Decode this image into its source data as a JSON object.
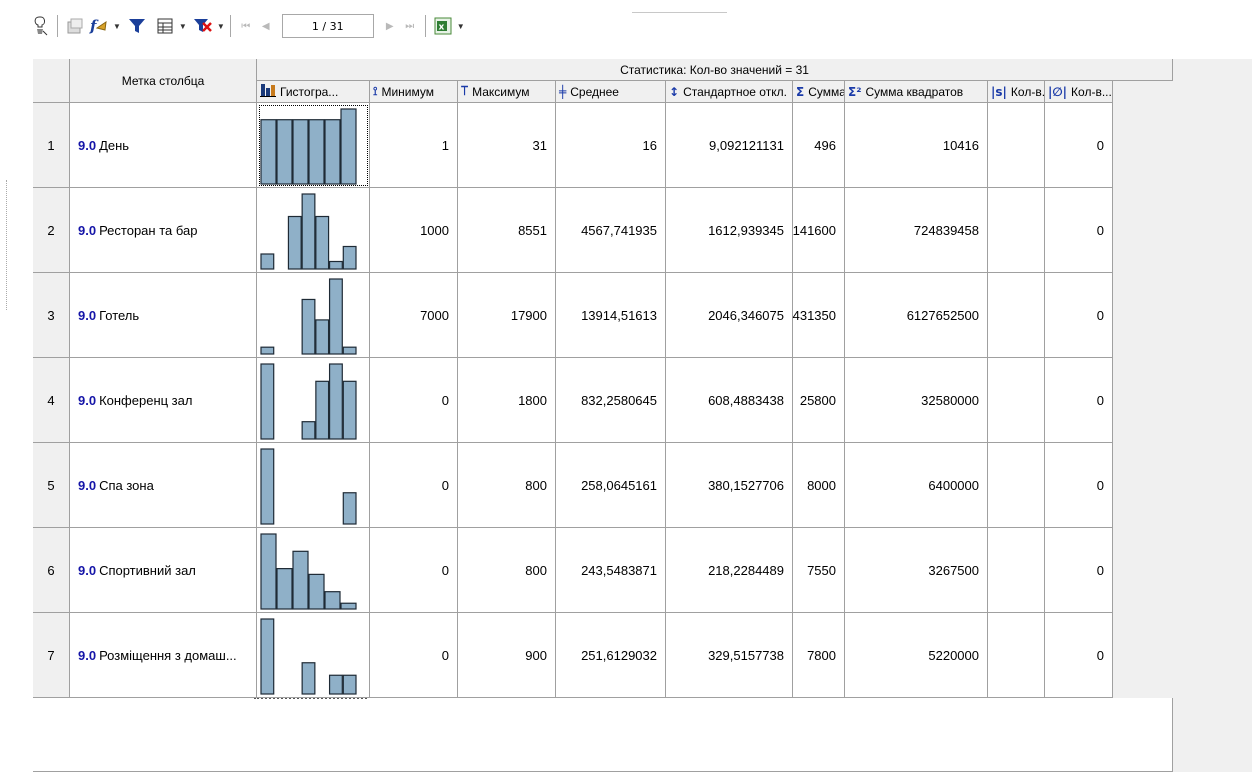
{
  "toolbar": {
    "icons": [
      "wizard-icon",
      "properties-icon",
      "formula-icon",
      "filter-icon",
      "table-view-icon",
      "clear-filter-icon"
    ],
    "page_indicator": "1 / 31",
    "export_icon": "excel-export-icon"
  },
  "grid": {
    "corner_label": "",
    "column_label_header": "Метка столбца",
    "group_header": "Статистика: Кол-во значений = 31",
    "columns": [
      {
        "key": "hist",
        "label": "Гистогра...",
        "icon": "histogram-icon",
        "sym": ""
      },
      {
        "key": "min",
        "label": "Минимум",
        "icon": "minimum-icon",
        "sym": "⟟"
      },
      {
        "key": "max",
        "label": "Максимум",
        "icon": "maximum-icon",
        "sym": "⟙"
      },
      {
        "key": "mean",
        "label": "Среднее",
        "icon": "mean-icon",
        "sym": "╪"
      },
      {
        "key": "std",
        "label": "Стандартное откл.",
        "icon": "std-dev-icon",
        "sym": "↕"
      },
      {
        "key": "sum",
        "label": "Сумма",
        "icon": "sum-icon",
        "sym": "Σ"
      },
      {
        "key": "sumsq",
        "label": "Сумма квадратов",
        "icon": "sum-squares-icon",
        "sym": "Σ²"
      },
      {
        "key": "cnt1",
        "label": "Кол-в...",
        "icon": "count-distinct-icon",
        "sym": "|s|"
      },
      {
        "key": "cnt2",
        "label": "Кол-в...",
        "icon": "count-empty-icon",
        "sym": "|∅|"
      }
    ],
    "rows": [
      {
        "no": "1",
        "tag": "9.0",
        "name": "День",
        "hist": [
          6,
          6,
          6,
          6,
          6,
          7
        ],
        "min": "1",
        "max": "31",
        "mean": "16",
        "std": "9,092121131",
        "sum": "496",
        "sumsq": "10416",
        "cnt1": "",
        "cnt2": "0"
      },
      {
        "no": "2",
        "tag": "9.0",
        "name": "Ресторан та бар",
        "hist": [
          2,
          0,
          7,
          10,
          7,
          1,
          3
        ],
        "min": "1000",
        "max": "8551",
        "mean": "4567,741935",
        "std": "1612,939345",
        "sum": "141600",
        "sumsq": "724839458",
        "cnt1": "",
        "cnt2": "0"
      },
      {
        "no": "3",
        "tag": "9.0",
        "name": "Готель",
        "hist": [
          1,
          0,
          0,
          8,
          5,
          11,
          1
        ],
        "min": "7000",
        "max": "17900",
        "mean": "13914,51613",
        "std": "2046,346075",
        "sum": "431350",
        "sumsq": "6127652500",
        "cnt1": "",
        "cnt2": "0"
      },
      {
        "no": "4",
        "tag": "9.0",
        "name": "Конференц зал",
        "hist": [
          13,
          0,
          0,
          3,
          10,
          13,
          10
        ],
        "min": "0",
        "max": "1800",
        "mean": "832,2580645",
        "std": "608,4883438",
        "sum": "25800",
        "sumsq": "32580000",
        "cnt1": "",
        "cnt2": "0"
      },
      {
        "no": "5",
        "tag": "9.0",
        "name": "Спа зона",
        "hist": [
          12,
          0,
          0,
          0,
          0,
          0,
          5
        ],
        "min": "0",
        "max": "800",
        "mean": "258,0645161",
        "std": "380,1527706",
        "sum": "8000",
        "sumsq": "6400000",
        "cnt1": "",
        "cnt2": "0"
      },
      {
        "no": "6",
        "tag": "9.0",
        "name": "Спортивний зал",
        "hist": [
          13,
          7,
          10,
          6,
          3,
          1
        ],
        "min": "0",
        "max": "800",
        "mean": "243,5483871",
        "std": "218,2284489",
        "sum": "7550",
        "sumsq": "3267500",
        "cnt1": "",
        "cnt2": "0"
      },
      {
        "no": "7",
        "tag": "9.0",
        "name": "Розміщення з домаш...",
        "hist": [
          12,
          0,
          0,
          5,
          0,
          3,
          3
        ],
        "min": "0",
        "max": "900",
        "mean": "251,6129032",
        "std": "329,5157738",
        "sum": "7800",
        "sumsq": "5220000",
        "cnt1": "",
        "cnt2": "0"
      }
    ]
  }
}
